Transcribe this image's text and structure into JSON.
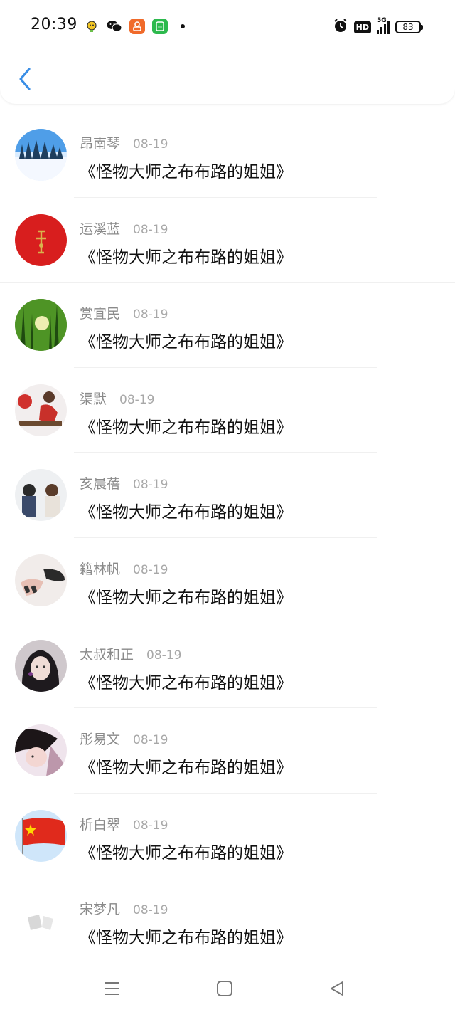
{
  "status_bar": {
    "time": "20:39",
    "notification_icons": [
      "assistant-icon",
      "wechat-icon",
      "app-orange-icon",
      "app-green-icon"
    ],
    "hd_label": "HD",
    "network_label": "5G",
    "battery": "83"
  },
  "header": {
    "back_icon": "chevron-left-icon",
    "accent_color": "#3a8ee6"
  },
  "comments": [
    {
      "name": "昂南琴",
      "date": "08-19",
      "text": "《怪物大师之布布路的姐姐》"
    },
    {
      "name": "运溪蓝",
      "date": "08-19",
      "text": "《怪物大师之布布路的姐姐》"
    },
    {
      "name": "赏宜民",
      "date": "08-19",
      "text": "《怪物大师之布布路的姐姐》"
    },
    {
      "name": "渠默",
      "date": "08-19",
      "text": "《怪物大师之布布路的姐姐》"
    },
    {
      "name": "亥晨蓓",
      "date": "08-19",
      "text": "《怪物大师之布布路的姐姐》"
    },
    {
      "name": "籍林帆",
      "date": "08-19",
      "text": "《怪物大师之布布路的姐姐》"
    },
    {
      "name": "太叔和正",
      "date": "08-19",
      "text": "《怪物大师之布布路的姐姐》"
    },
    {
      "name": "彤易文",
      "date": "08-19",
      "text": "《怪物大师之布布路的姐姐》"
    },
    {
      "name": "析白翠",
      "date": "08-19",
      "text": "《怪物大师之布布路的姐姐》"
    },
    {
      "name": "宋梦凡",
      "date": "08-19",
      "text": "《怪物大师之布布路的姐姐》"
    }
  ],
  "nav_bar": {
    "icons": [
      "menu-icon",
      "home-icon",
      "back-triangle-icon"
    ]
  }
}
